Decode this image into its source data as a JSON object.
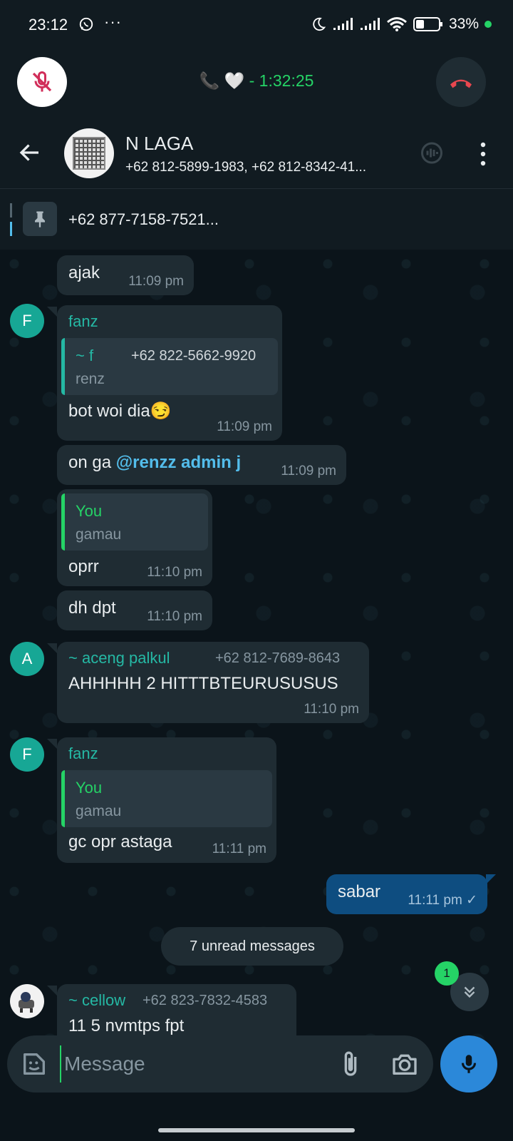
{
  "status_bar": {
    "time": "23:12",
    "dots": "···",
    "battery": "33%"
  },
  "call": {
    "status_prefix": "🤍",
    "duration": " - 1:32:25"
  },
  "header": {
    "name": "N LAGA",
    "members": "+62 812-5899-1983, +62 812-8342-41..."
  },
  "pinned": {
    "text": "+62 877-7158-7521..."
  },
  "messages": [
    {
      "text": "ajak",
      "time": "11:09 pm"
    },
    {
      "avatar": "F",
      "sender": "fanz",
      "quote_name": "~ f",
      "quote_phone": "+62 822-5662-9920",
      "quote_text": "renz",
      "text": "bot woi dia😏",
      "time": "11:09 pm"
    },
    {
      "text_plain": "on ga ",
      "mention": "@renzz admin j",
      "time": "11:09 pm"
    },
    {
      "quote_name": "You",
      "quote_text": "gamau",
      "text": "oprr",
      "time": "11:10 pm"
    },
    {
      "text": "dh dpt",
      "time": "11:10 pm"
    },
    {
      "avatar": "A",
      "sender": "~ aceng palkul",
      "phone": "+62 812-7689-8643",
      "text": "AHHHHH 2 HITTTBTEURUSUSUS",
      "time": "11:10 pm"
    },
    {
      "avatar": "F",
      "sender": "fanz",
      "quote_name": "You",
      "quote_text": "gamau",
      "text": "gc opr astaga",
      "time": "11:11 pm"
    },
    {
      "outgoing": true,
      "text": "sabar",
      "time": "11:11 pm ✓"
    },
    {
      "sender": "~ cellow",
      "phone": "+62 823-7832-4583",
      "text": "11 5 nvmtps fpt"
    }
  ],
  "unread_label": "7 unread messages",
  "unread_badge": "1",
  "input": {
    "placeholder": "Message"
  },
  "colors": {
    "accent_green": "#25d366",
    "mention_blue": "#53bdeb",
    "outgoing_bubble": "#0e4d80",
    "end_call_red": "#e8474f"
  }
}
